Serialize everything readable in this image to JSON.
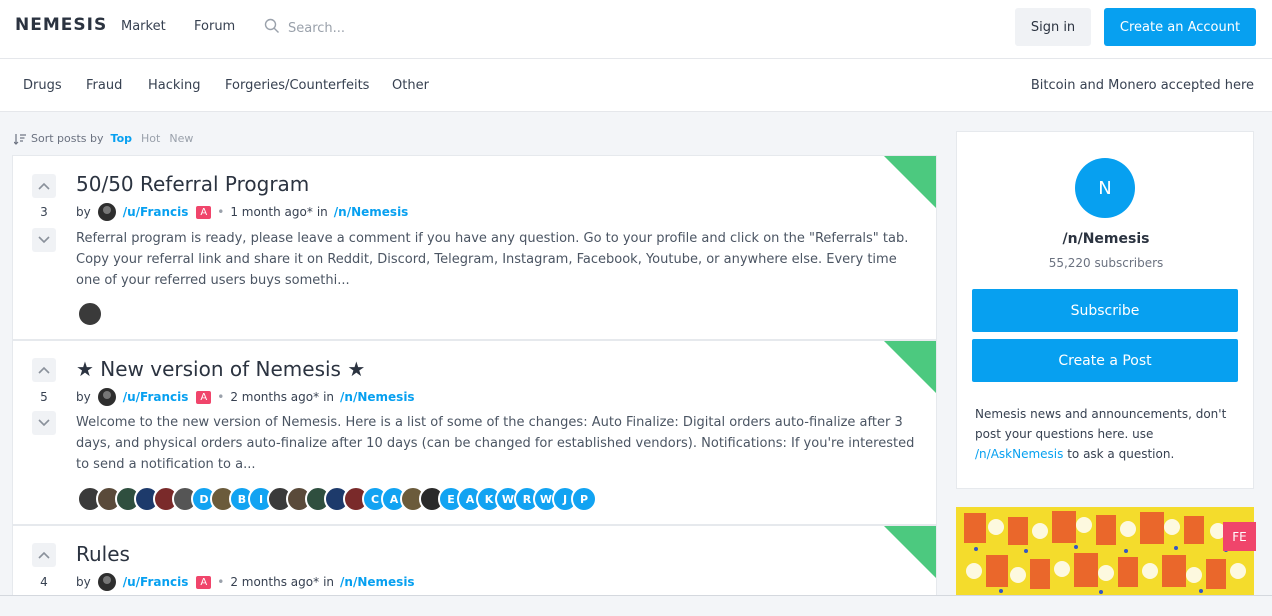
{
  "header": {
    "logo": "NEMESIS",
    "nav": [
      "Market",
      "Forum"
    ],
    "search_placeholder": "Search...",
    "signin": "Sign in",
    "create_account": "Create an Account"
  },
  "categories": [
    "Drugs",
    "Fraud",
    "Hacking",
    "Forgeries/Counterfeits",
    "Other"
  ],
  "payment_note": "Bitcoin and Monero accepted here",
  "sort": {
    "label": "Sort posts by",
    "options": [
      "Top",
      "Hot",
      "New"
    ],
    "selected": "Top"
  },
  "posts": [
    {
      "votes": "3",
      "title": "50/50 Referral Program",
      "by": "by",
      "author": "/u/Francis",
      "badge": "A",
      "time": "1 month ago*",
      "in": "in",
      "sub": "/n/Nemesis",
      "excerpt": "Referral program is ready, please leave a comment if you have any question. Go to your profile and click on the \"Referrals\" tab. Copy your referral link and share it on Reddit, Discord, Telegram, Instagram, Facebook, Youtube, or anywhere else. Every time one of your referred users buys somethi...",
      "commenters": [
        "img"
      ]
    },
    {
      "votes": "5",
      "title": "★ New version of Nemesis ★",
      "by": "by",
      "author": "/u/Francis",
      "badge": "A",
      "time": "2 months ago*",
      "in": "in",
      "sub": "/n/Nemesis",
      "excerpt": "Welcome to the new version of Nemesis. Here is a list of some of the changes: Auto Finalize: Digital orders auto-finalize after 3 days, and physical orders auto-finalize after 10 days (can be changed for established vendors). Notifications: If you're interested to send a notification to a...",
      "commenters": [
        "img",
        "img",
        "img",
        "img",
        "img",
        "img",
        "D",
        "img",
        "B",
        "I",
        "img",
        "img",
        "img",
        "img",
        "img",
        "C",
        "A",
        "img",
        "img",
        "E",
        "A",
        "K",
        "W",
        "R",
        "W",
        "J",
        "P"
      ]
    },
    {
      "votes": "4",
      "title": "Rules",
      "by": "by",
      "author": "/u/Francis",
      "badge": "A",
      "time": "2 months ago*",
      "in": "in",
      "sub": "/n/Nemesis"
    }
  ],
  "sidebar": {
    "logo_letter": "N",
    "name": "/n/Nemesis",
    "subscribers": "55,220 subscribers",
    "subscribe": "Subscribe",
    "create_post": "Create a Post",
    "desc_before": "Nemesis news and announcements, don't post your questions here. use",
    "desc_link": "/n/AskNemesis",
    "desc_after": "to ask a question."
  },
  "banner_badge": "FE",
  "colors": {
    "accent": "#07a0f0",
    "admin_badge": "#f0456b",
    "corner": "#4cc97f"
  }
}
